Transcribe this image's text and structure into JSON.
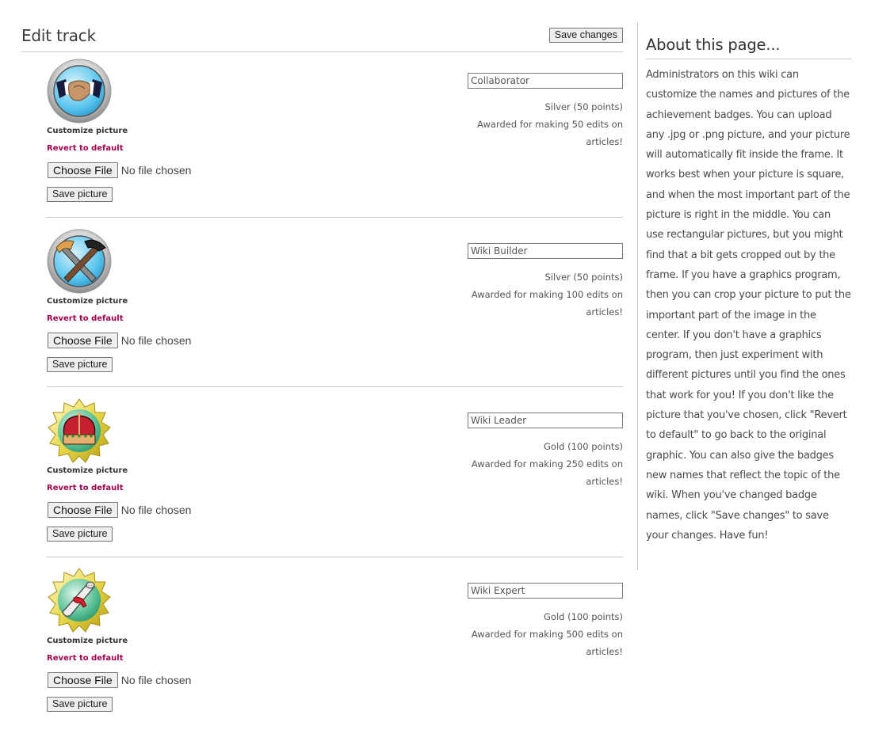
{
  "header": {
    "title": "Edit track",
    "save_changes_label": "Save changes"
  },
  "badges": [
    {
      "icon": "handshake-badge-icon",
      "customize_label": "Customize picture",
      "revert_label": "Revert to default",
      "choose_file_label": "Choose File",
      "file_status": "No file chosen",
      "save_picture_label": "Save picture",
      "name_value": "Collaborator",
      "level": "Silver (50 points)",
      "description": "Awarded for making 50 edits on articles!"
    },
    {
      "icon": "hammer-badge-icon",
      "customize_label": "Customize picture",
      "revert_label": "Revert to default",
      "choose_file_label": "Choose File",
      "file_status": "No file chosen",
      "save_picture_label": "Save picture",
      "name_value": "Wiki Builder",
      "level": "Silver (50 points)",
      "description": "Awarded for making 100 edits on articles!"
    },
    {
      "icon": "crown-badge-icon",
      "customize_label": "Customize picture",
      "revert_label": "Revert to default",
      "choose_file_label": "Choose File",
      "file_status": "No file chosen",
      "save_picture_label": "Save picture",
      "name_value": "Wiki Leader",
      "level": "Gold (100 points)",
      "description": "Awarded for making 250 edits on articles!"
    },
    {
      "icon": "scroll-badge-icon",
      "customize_label": "Customize picture",
      "revert_label": "Revert to default",
      "choose_file_label": "Choose File",
      "file_status": "No file chosen",
      "save_picture_label": "Save picture",
      "name_value": "Wiki Expert",
      "level": "Gold (100 points)",
      "description": "Awarded for making 500 edits on articles!"
    }
  ],
  "sidebar": {
    "title": "About this page...",
    "text": "Administrators on this wiki can customize the names and pictures of the achievement badges. You can upload any .jpg or .png picture, and your picture will automatically fit inside the frame. It works best when your picture is square, and when the most important part of the picture is right in the middle. You can use rectangular pictures, but you might find that a bit gets cropped out by the frame. If you have a graphics program, then you can crop your picture to put the important part of the image in the center. If you don't have a graphics program, then just experiment with different pictures until you find the ones that work for you! If you don't like the picture that you've chosen, click \"Revert to default\" to go back to the original graphic. You can also give the badges new names that reflect the topic of the wiki. When you've changed badge names, click \"Save changes\" to save your changes. Have fun!"
  },
  "colors": {
    "revert_link": "#a0004d",
    "separator": "#c8c8c8",
    "silver_badge_bg": "#5bc6ee",
    "gold_badge_bg": "#3fae86"
  }
}
